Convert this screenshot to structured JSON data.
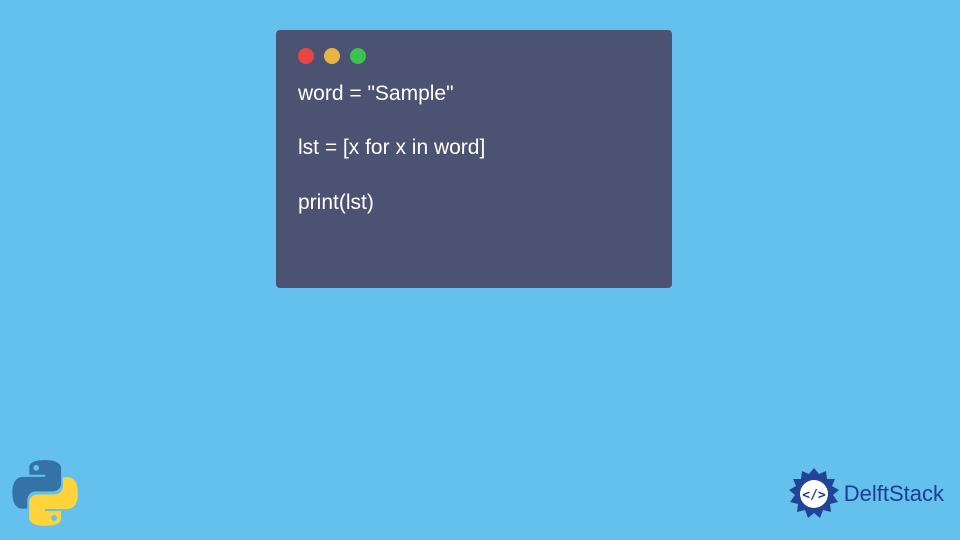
{
  "code": {
    "line1": "word = \"Sample\"",
    "line2": "",
    "line3": "lst = [x for x in word]",
    "line4": "",
    "line5": "print(lst)"
  },
  "branding": {
    "delft_text": "DelftStack"
  },
  "colors": {
    "background": "#64c1ed",
    "code_window": "#4b5272",
    "dot_red": "#e84545",
    "dot_yellow": "#e8b544",
    "dot_green": "#3dc250",
    "brand_blue": "#1d3d8f"
  }
}
